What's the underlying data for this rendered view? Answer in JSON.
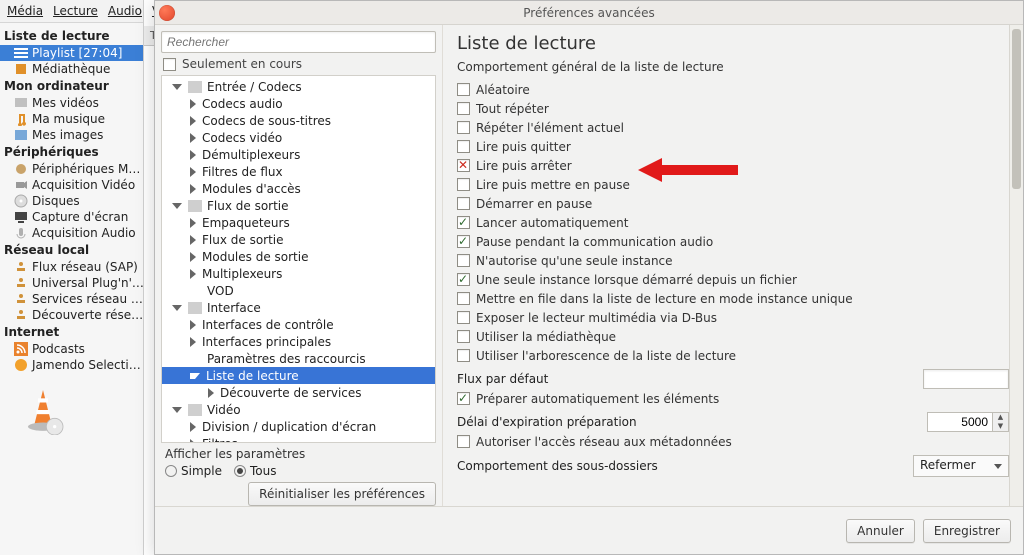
{
  "menubar": {
    "media": "Média",
    "lecture": "Lecture",
    "audio": "Audio",
    "video": "Vidéo"
  },
  "library": {
    "playlist": {
      "header": "Liste de lecture",
      "item": "Playlist [27:04]",
      "media": "Médiathèque"
    },
    "computer": {
      "header": "Mon ordinateur",
      "videos": "Mes vidéos",
      "music": "Ma musique",
      "images": "Mes images"
    },
    "periph": {
      "header": "Périphériques",
      "dev": "Périphériques M…",
      "acqv": "Acquisition Vidéo",
      "disks": "Disques",
      "capture": "Capture d'écran",
      "acqa": "Acquisition Audio"
    },
    "lan": {
      "header": "Réseau local",
      "sap": "Flux réseau (SAP)",
      "upnp": "Universal Plug'n'…",
      "servnet": "Services réseau …",
      "discover": "Découverte rése…"
    },
    "internet": {
      "header": "Internet",
      "podcasts": "Podcasts",
      "jamendo": "Jamendo Selecti…"
    }
  },
  "list_header": "Titre",
  "dialog": {
    "title": "Préférences avancées",
    "search_placeholder": "Rechercher",
    "only_current": "Seulement en cours",
    "tree": {
      "entry_codecs": "Entrée / Codecs",
      "codecs_audio": "Codecs audio",
      "codecs_st": "Codecs de sous-titres",
      "codecs_video": "Codecs vidéo",
      "demux": "Démultiplexeurs",
      "filtres_flux": "Filtres de flux",
      "modules_acces": "Modules d'accès",
      "flux_sortie": "Flux de sortie",
      "empaq": "Empaqueteurs",
      "flux_sortie2": "Flux de sortie",
      "modules_sortie": "Modules de sortie",
      "multiplex": "Multiplexeurs",
      "vod": "VOD",
      "interface": "Interface",
      "ifc_ctrl": "Interfaces de contrôle",
      "ifc_main": "Interfaces principales",
      "shortcuts": "Paramètres des raccourcis",
      "playlist": "Liste de lecture",
      "discover": "Découverte de services",
      "video": "Vidéo",
      "dup": "Division / duplication d'écran",
      "filtres": "Filtres"
    },
    "show_params": "Afficher les paramètres",
    "radio_simple": "Simple",
    "radio_all": "Tous",
    "reset": "Réinitialiser les préférences",
    "right": {
      "title": "Liste de lecture",
      "subtitle": "Comportement général de la liste de lecture",
      "opts": {
        "random": "Aléatoire",
        "repeat_all": "Tout répéter",
        "repeat_cur": "Répéter l'élément actuel",
        "play_quit": "Lire puis quitter",
        "play_stop": "Lire puis arrêter",
        "play_pause": "Lire puis mettre en pause",
        "start_paused": "Démarrer en pause",
        "autostart": "Lancer automatiquement",
        "pause_comm": "Pause pendant la communication audio",
        "single_inst": "N'autorise qu'une seule instance",
        "single_file": "Une seule instance lorsque démarré depuis un fichier",
        "enqueue": "Mettre en file dans la liste de lecture en mode instance unique",
        "dbus": "Exposer le lecteur multimédia via D-Bus",
        "use_media": "Utiliser la médiathèque",
        "use_tree": "Utiliser l'arborescence de la liste de lecture"
      },
      "default_stream": "Flux par défaut",
      "auto_prep": "Préparer automatiquement les éléments",
      "prep_timeout": "Délai d'expiration préparation",
      "prep_timeout_val": "5000",
      "allow_net": "Autoriser l'accès réseau aux métadonnées",
      "subfolders": "Comportement des sous-dossiers",
      "subfolders_val": "Refermer"
    },
    "cancel": "Annuler",
    "save": "Enregistrer"
  }
}
